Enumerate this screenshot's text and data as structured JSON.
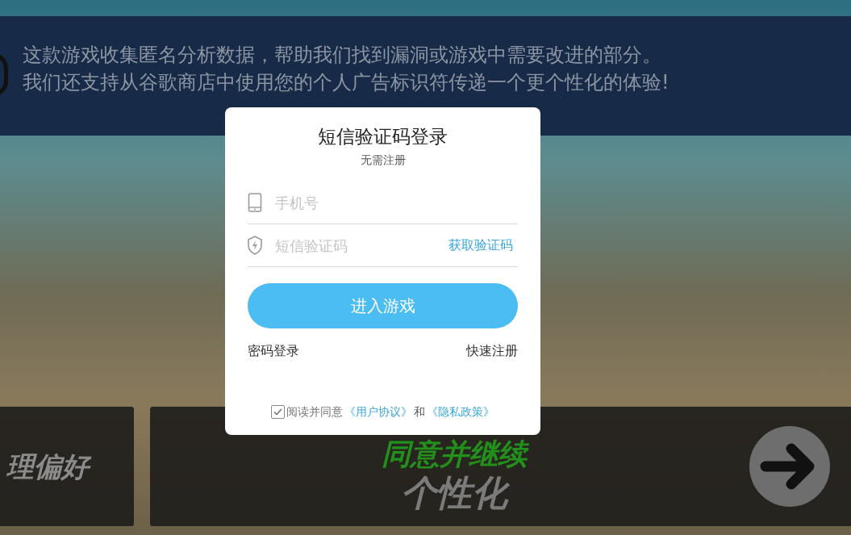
{
  "banner": {
    "lines": [
      "这款游戏收集匿名分析数据，帮助我们找到漏洞或游戏中需要改进的部分。",
      "我们还支持从谷歌商店中使用您的个人广告标识符传递一个更个性化的体验!"
    ]
  },
  "bottom": {
    "left_label": "理偏好",
    "accept_title": "同意并继续",
    "accept_subtitle": "个性化"
  },
  "dialog": {
    "title": "短信验证码登录",
    "subtitle": "无需注册",
    "fields": [
      {
        "kind": "phone",
        "placeholder": "手机号"
      },
      {
        "kind": "code",
        "placeholder": "短信验证码",
        "action": "获取验证码"
      }
    ],
    "submit": "进入游戏",
    "left_link": "密码登录",
    "right_link": "快速注册",
    "agreement": {
      "checked": true,
      "text": "阅读并同意",
      "link1": "《用户协议》",
      "joiner": "和",
      "link2": "《隐私政策》"
    }
  }
}
